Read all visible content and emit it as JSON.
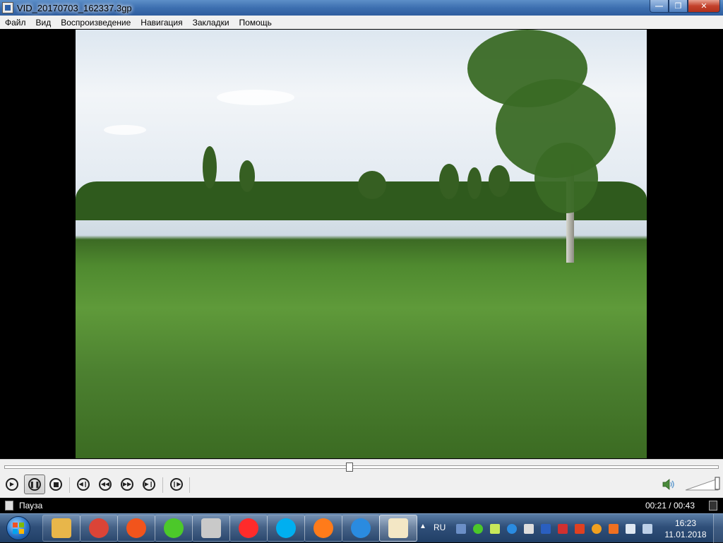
{
  "window": {
    "title": "VID_20170703_162337.3gp"
  },
  "menu": {
    "items": [
      "Файл",
      "Вид",
      "Воспроизведение",
      "Навигация",
      "Закладки",
      "Помощь"
    ]
  },
  "player": {
    "progress": 0.483,
    "status": "Пауза",
    "time": "00:21 / 00:43",
    "volume": 1.0
  },
  "icons": {
    "play": "play-icon",
    "pause": "pause-icon",
    "stop": "stop-icon",
    "prev": "skip-previous-icon",
    "rewind": "rewind-icon",
    "forward": "fast-forward-icon",
    "next": "skip-next-icon",
    "frame_step": "frame-step-icon",
    "volume": "speaker-icon"
  },
  "taskbar": {
    "apps": [
      {
        "name": "file-explorer",
        "color": "#e8b64a"
      },
      {
        "name": "chrome",
        "color": "#db4437"
      },
      {
        "name": "app-orange",
        "color": "#f2541c"
      },
      {
        "name": "icq",
        "color": "#4cc82a"
      },
      {
        "name": "scanner",
        "color": "#c9c9c9"
      },
      {
        "name": "yandex-browser",
        "color": "#ff2b2b"
      },
      {
        "name": "skype",
        "color": "#00aff0"
      },
      {
        "name": "firefox",
        "color": "#ff7b1a"
      },
      {
        "name": "zona",
        "color": "#2a8be0"
      },
      {
        "name": "media-player",
        "color": "#f3e7c5"
      }
    ],
    "language": "RU",
    "clock_time": "16:23",
    "clock_date": "11.01.2018"
  }
}
